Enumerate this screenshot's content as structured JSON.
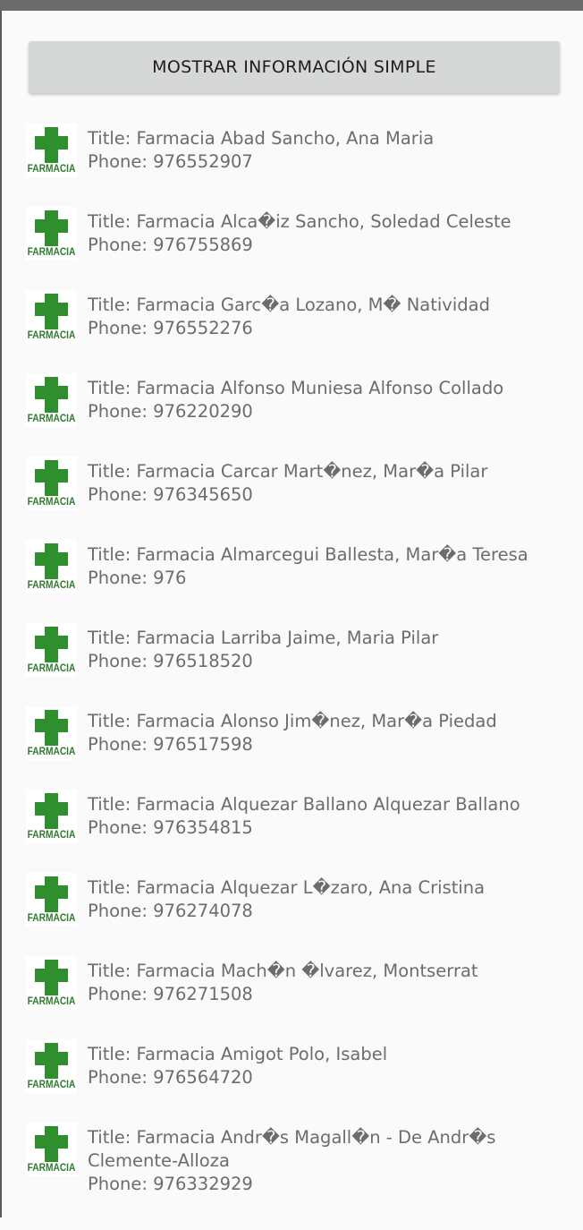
{
  "button": {
    "label": "MOSTRAR INFORMACIÓN SIMPLE"
  },
  "logo_text": "FARMACIA",
  "icons": {
    "status": "status-bar",
    "item": "pharmacy-cross-icon"
  },
  "colors": {
    "cross": "#2f8f2f",
    "logo_text": "#2f7a2f",
    "button_bg": "#d6d7d7",
    "text": "#6c6c6c"
  },
  "items": [
    {
      "title": "Title: Farmacia Abad Sancho, Ana Maria",
      "phone": "Phone: 976552907"
    },
    {
      "title": "Title: Farmacia Alca�iz Sancho, Soledad Celeste",
      "phone": "Phone: 976755869"
    },
    {
      "title": "Title: Farmacia Garc�a Lozano, M� Natividad",
      "phone": "Phone: 976552276"
    },
    {
      "title": "Title: Farmacia Alfonso Muniesa Alfonso Collado",
      "phone": "Phone: 976220290"
    },
    {
      "title": "Title: Farmacia Carcar Mart�nez, Mar�a Pilar",
      "phone": "Phone: 976345650"
    },
    {
      "title": "Title: Farmacia Almarcegui Ballesta, Mar�a Teresa",
      "phone": "Phone: 976"
    },
    {
      "title": "Title: Farmacia Larriba Jaime, Maria Pilar",
      "phone": "Phone: 976518520"
    },
    {
      "title": "Title: Farmacia Alonso Jim�nez, Mar�a Piedad",
      "phone": "Phone: 976517598"
    },
    {
      "title": "Title: Farmacia Alquezar Ballano Alquezar Ballano",
      "phone": "Phone: 976354815"
    },
    {
      "title": "Title: Farmacia Alquezar L�zaro, Ana Cristina",
      "phone": "Phone: 976274078"
    },
    {
      "title": "Title: Farmacia Mach�n �lvarez, Montserrat",
      "phone": "Phone: 976271508"
    },
    {
      "title": "Title: Farmacia Amigot Polo, Isabel",
      "phone": "Phone: 976564720"
    },
    {
      "title": "Title: Farmacia Andr�s Magall�n -  De Andr�s Clemente-Alloza",
      "phone": "Phone: 976332929"
    }
  ]
}
